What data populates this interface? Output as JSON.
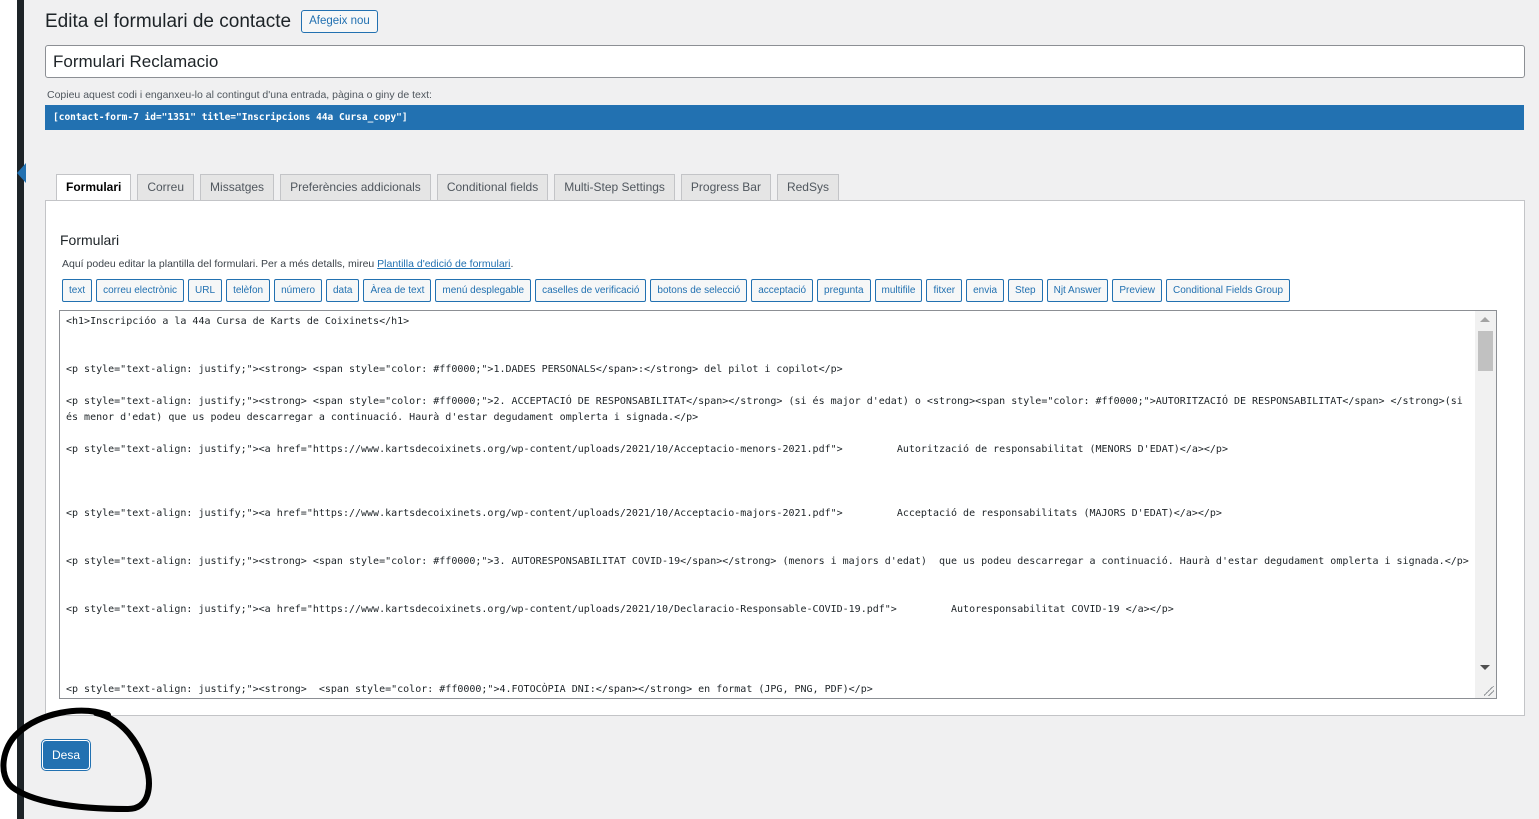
{
  "header": {
    "title": "Edita el formulari de contacte",
    "add_new": "Afegeix nou"
  },
  "form": {
    "title_value": "Formulari Reclamacio"
  },
  "shortcode": {
    "description": "Copieu aquest codi i enganxeu-lo al contingut d'una entrada, pàgina o giny de text:",
    "code": "[contact-form-7 id=\"1351\" title=\"Inscripcions 44a Cursa_copy\"]"
  },
  "tabs": [
    {
      "label": "Formulari",
      "active": true
    },
    {
      "label": "Correu"
    },
    {
      "label": "Missatges"
    },
    {
      "label": "Preferències addicionals"
    },
    {
      "label": "Conditional fields"
    },
    {
      "label": "Multi-Step Settings"
    },
    {
      "label": "Progress Bar"
    },
    {
      "label": "RedSys"
    }
  ],
  "panel": {
    "title": "Formulari",
    "desc_prefix": "Aquí podeu editar la plantilla del formulari. Per a més detalls, mireu ",
    "desc_link": "Plantilla d'edició de formulari",
    "desc_suffix": ".",
    "tag_buttons": [
      "text",
      "correu electrònic",
      "URL",
      "telèfon",
      "número",
      "data",
      "Àrea de text",
      "menú desplegable",
      "caselles de verificació",
      "botons de selecció",
      "acceptació",
      "pregunta",
      "multifile",
      "fitxer",
      "envia",
      "Step",
      "Njt Answer",
      "Preview",
      "Conditional Fields Group"
    ]
  },
  "editor": {
    "lines": [
      "<h1>Inscripcióo a la 44a Cursa de Karts de Coixinets</h1>",
      "<p style=\"text-align: justify;\"><strong> <span style=\"color: #ff0000;\">1.DADES PERSONALS</span>:</strong> del pilot i copilot</p>",
      "<p style=\"text-align: justify;\"><strong> <span style=\"color: #ff0000;\">2. ACCEPTACIÓ DE RESPONSABILITAT</span></strong> (si és major d'edat) o <strong><span style=\"color: #ff0000;\">AUTORITZACIÓ DE RESPONSABILITAT</span> </strong>(si és menor d'edat) que us podeu descarregar a continuació. Haurà d'estar degudament omplerta i signada.</p>",
      "<p style=\"text-align: justify;\"><a href=\"https://www.kartsdecoixinets.org/wp-content/uploads/2021/10/Acceptacio-menors-2021.pdf\">         Autorització de responsabilitat (MENORS D'EDAT)</a></p>",
      "<p style=\"text-align: justify;\"><a href=\"https://www.kartsdecoixinets.org/wp-content/uploads/2021/10/Acceptacio-majors-2021.pdf\">         Acceptació de responsabilitats (MAJORS D'EDAT)</a></p>",
      "<p style=\"text-align: justify;\"><strong> <span style=\"color: #ff0000;\">3. AUTORESPONSABILITAT COVID-19</span></strong> (menors i majors d'edat)  que us podeu descarregar a continuació. Haurà d'estar degudament omplerta i signada.</p>",
      "<p style=\"text-align: justify;\"><a href=\"https://www.kartsdecoixinets.org/wp-content/uploads/2021/10/Declaracio-Responsable-COVID-19.pdf\">         Autoresponsabilitat COVID-19 </a></p>",
      "<p style=\"text-align: justify;\"><strong>  <span style=\"color: #ff0000;\">4.FOTOCÒPIA DNI:</span></strong> en format (JPG, PNG, PDF)</p>"
    ]
  },
  "actions": {
    "save": "Desa"
  }
}
